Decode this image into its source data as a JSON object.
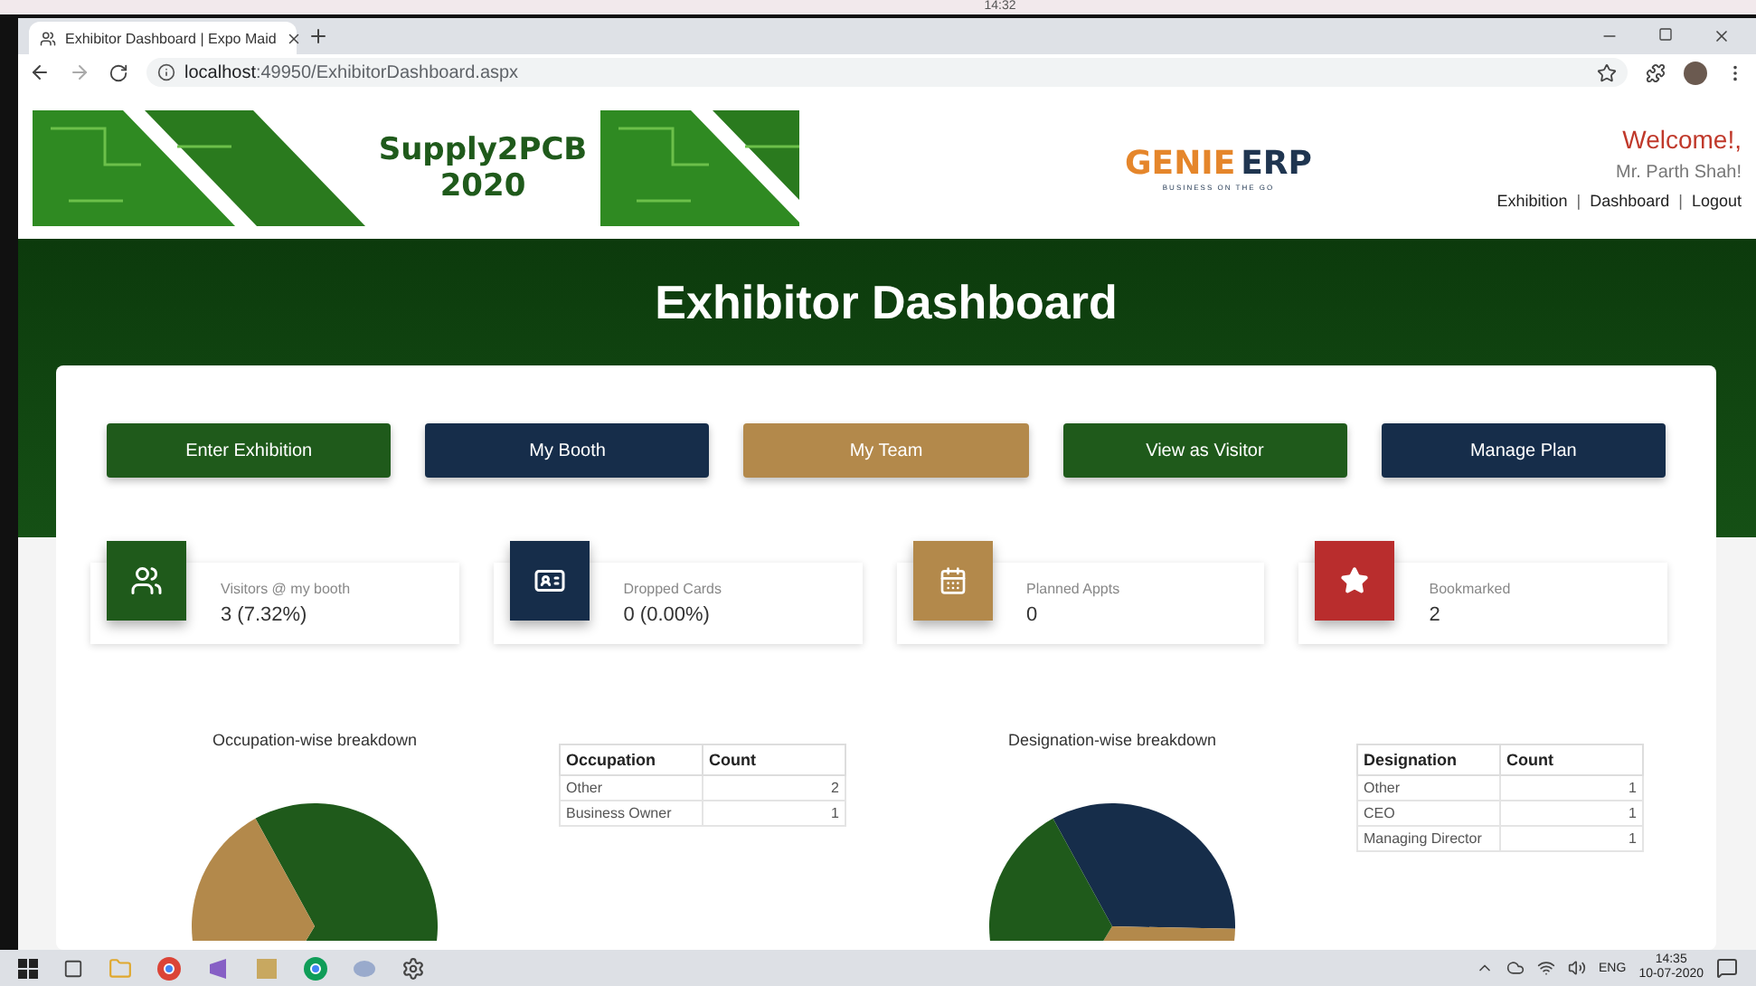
{
  "desktop": {
    "clock": "14:32"
  },
  "browser": {
    "tab": {
      "title": "Exhibitor Dashboard | Expo Maid",
      "selected": true
    },
    "url_host": "localhost",
    "url_rest": ":49950/ExhibitorDashboard.aspx"
  },
  "header": {
    "event_name": "Supply2PCB",
    "event_year": "2020",
    "brand": {
      "word_1": "GENIE",
      "word_2": "ERP",
      "tagline": "BUSINESS ON THE GO"
    },
    "welcome": "Welcome!,",
    "user": "Mr. Parth Shah!",
    "links": [
      "Exhibition",
      "Dashboard",
      "Logout"
    ],
    "separator": "|"
  },
  "banner": {
    "title": "Exhibitor Dashboard"
  },
  "actions": [
    {
      "label": "Enter Exhibition",
      "color": "#1f5a1b"
    },
    {
      "label": "My Booth",
      "color": "#162d4a"
    },
    {
      "label": "My Team",
      "color": "#b3894b"
    },
    {
      "label": "View as Visitor",
      "color": "#1f5a1b"
    },
    {
      "label": "Manage Plan",
      "color": "#162d4a"
    }
  ],
  "stats": [
    {
      "kind": "people",
      "label": "Visitors @ my booth",
      "value": "3  (7.32%)",
      "color": "#1f5a1b"
    },
    {
      "kind": "card",
      "label": "Dropped Cards",
      "value": "0  (0.00%)",
      "color": "#162d4a"
    },
    {
      "kind": "calendar",
      "label": "Planned Appts",
      "value": "0",
      "color": "#b3894b"
    },
    {
      "kind": "star",
      "label": "Bookmarked",
      "value": "2",
      "color": "#b92d2d"
    }
  ],
  "breakdowns": [
    {
      "title": "Occupation-wise breakdown",
      "columns": [
        "Occupation",
        "Count"
      ],
      "rows": [
        {
          "cells": [
            "Other",
            "2"
          ]
        },
        {
          "cells": [
            "Business Owner",
            "1"
          ]
        }
      ],
      "pie_slices": [
        {
          "color": "#1f5a1b"
        },
        {
          "color": "#b3894b"
        }
      ]
    },
    {
      "title": "Designation-wise breakdown",
      "columns": [
        "Designation",
        "Count"
      ],
      "rows": [
        {
          "cells": [
            "Other",
            "1"
          ]
        },
        {
          "cells": [
            "CEO",
            "1"
          ]
        },
        {
          "cells": [
            "Managing Director",
            "1"
          ]
        }
      ],
      "pie_slices": [
        {
          "color": "#162d4a"
        },
        {
          "color": "#b3894b"
        },
        {
          "color": "#1f5a1b"
        }
      ]
    }
  ],
  "taskbar": {
    "language": "ENG",
    "time": "14:35",
    "date": "10-07-2020"
  }
}
